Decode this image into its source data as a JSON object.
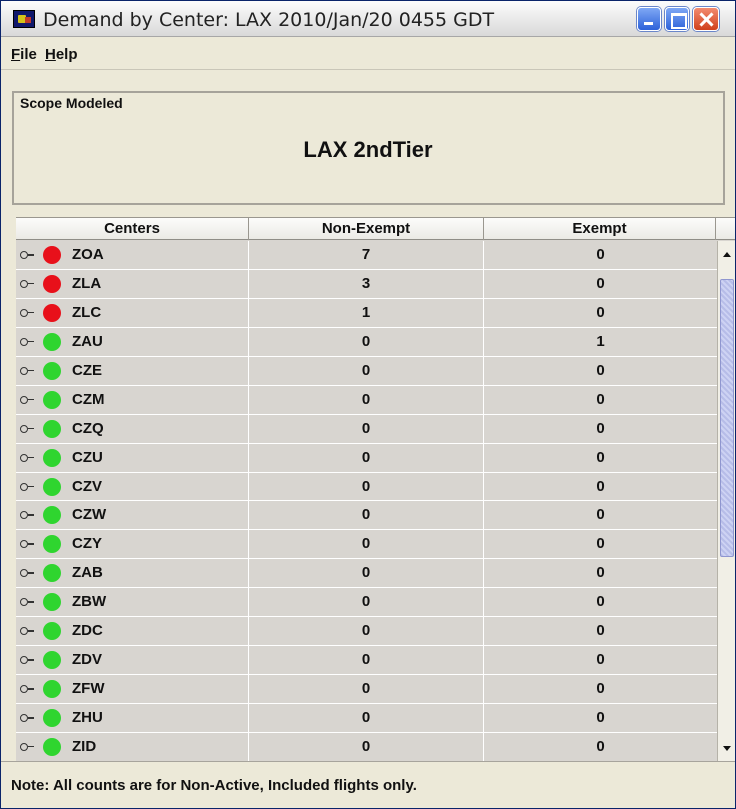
{
  "window": {
    "title": "Demand by Center: LAX 2010/Jan/20 0455 GDT"
  },
  "menu": {
    "file": {
      "mnemonic": "F",
      "rest": "ile"
    },
    "help": {
      "mnemonic": "H",
      "rest": "elp"
    }
  },
  "scope": {
    "legend": "Scope Modeled",
    "value": "LAX 2ndTier"
  },
  "table": {
    "headers": [
      "Centers",
      "Non-Exempt",
      "Exempt"
    ],
    "rows": [
      {
        "center": "ZOA",
        "status": "red",
        "non_exempt": "7",
        "exempt": "0"
      },
      {
        "center": "ZLA",
        "status": "red",
        "non_exempt": "3",
        "exempt": "0"
      },
      {
        "center": "ZLC",
        "status": "red",
        "non_exempt": "1",
        "exempt": "0"
      },
      {
        "center": "ZAU",
        "status": "green",
        "non_exempt": "0",
        "exempt": "1"
      },
      {
        "center": "CZE",
        "status": "green",
        "non_exempt": "0",
        "exempt": "0"
      },
      {
        "center": "CZM",
        "status": "green",
        "non_exempt": "0",
        "exempt": "0"
      },
      {
        "center": "CZQ",
        "status": "green",
        "non_exempt": "0",
        "exempt": "0"
      },
      {
        "center": "CZU",
        "status": "green",
        "non_exempt": "0",
        "exempt": "0"
      },
      {
        "center": "CZV",
        "status": "green",
        "non_exempt": "0",
        "exempt": "0"
      },
      {
        "center": "CZW",
        "status": "green",
        "non_exempt": "0",
        "exempt": "0"
      },
      {
        "center": "CZY",
        "status": "green",
        "non_exempt": "0",
        "exempt": "0"
      },
      {
        "center": "ZAB",
        "status": "green",
        "non_exempt": "0",
        "exempt": "0"
      },
      {
        "center": "ZBW",
        "status": "green",
        "non_exempt": "0",
        "exempt": "0"
      },
      {
        "center": "ZDC",
        "status": "green",
        "non_exempt": "0",
        "exempt": "0"
      },
      {
        "center": "ZDV",
        "status": "green",
        "non_exempt": "0",
        "exempt": "0"
      },
      {
        "center": "ZFW",
        "status": "green",
        "non_exempt": "0",
        "exempt": "0"
      },
      {
        "center": "ZHU",
        "status": "green",
        "non_exempt": "0",
        "exempt": "0"
      },
      {
        "center": "ZID",
        "status": "green",
        "non_exempt": "0",
        "exempt": "0"
      }
    ]
  },
  "status_colors": {
    "red": "#e8101a",
    "green": "#2fd52f"
  },
  "icons": {
    "app": "app-icon",
    "expander": "expand-key-icon",
    "status": "status-dot-icon"
  },
  "footer": {
    "note": "Note: All counts are for Non-Active, Included flights only."
  }
}
